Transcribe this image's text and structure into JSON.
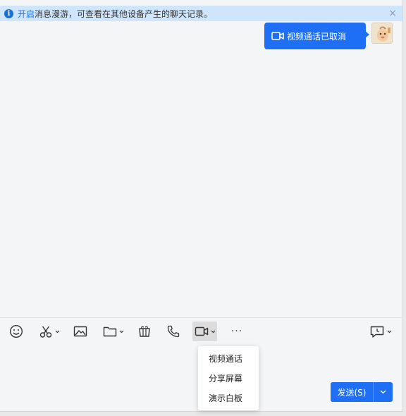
{
  "notice": {
    "link_text": "开启",
    "message": "消息漫游，可查看在其他设备产生的聊天记录。",
    "close_glyph": "×"
  },
  "messages": [
    {
      "text": "视频通话已取消",
      "icon": "video-camera-icon",
      "sender": "self"
    }
  ],
  "toolbar": {
    "items": [
      "emoji-icon",
      "scissors-icon",
      "image-icon",
      "folder-icon",
      "gift-box-icon",
      "phone-icon",
      "video-camera-icon",
      "more-icon",
      "history-icon"
    ],
    "more_glyph": "···"
  },
  "video_menu": {
    "items": [
      "视频通话",
      "分享屏幕",
      "演示白板"
    ]
  },
  "send": {
    "label": "发送(S)"
  },
  "colors": {
    "accent": "#1e6ff5",
    "notice_bg": "#cfe5fb",
    "link": "#1a73e8",
    "chat_bg": "#f4f5f7"
  }
}
